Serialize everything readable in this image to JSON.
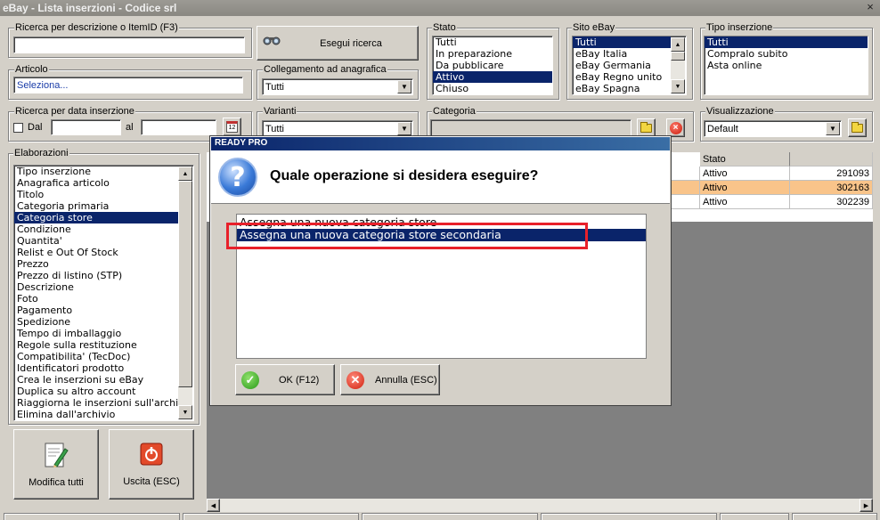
{
  "window": {
    "title": "eBay - Lista inserzioni - Codice srl",
    "close_glyph": "×"
  },
  "search": {
    "label": "Ricerca per descrizione o ItemID (F3)",
    "value": "",
    "button_label": "Esegui ricerca"
  },
  "articolo": {
    "label": "Articolo",
    "link": "Seleziona..."
  },
  "collegamento": {
    "label": "Collegamento ad anagrafica",
    "value": "Tutti"
  },
  "data_inserzione": {
    "label": "Ricerca per data inserzione",
    "dal_label": "Dal",
    "al_label": "al",
    "calendar_glyph": "12"
  },
  "varianti": {
    "label": "Varianti",
    "value": "Tutti"
  },
  "categoria": {
    "label": "Categoria",
    "value": ""
  },
  "stato": {
    "label": "Stato",
    "items": [
      "Tutti",
      "In preparazione",
      "Da pubblicare",
      "Attivo",
      "Chiuso"
    ],
    "selected_index": 3
  },
  "sito_ebay": {
    "label": "Sito eBay",
    "items": [
      "Tutti",
      "eBay Italia",
      "eBay Germania",
      "eBay Regno unito",
      "eBay Spagna"
    ],
    "selected_index": 0
  },
  "tipo_inserzione": {
    "label": "Tipo inserzione",
    "items": [
      "Tutti",
      "Compralo subito",
      "Asta online"
    ],
    "selected_index": 0
  },
  "visualizzazione": {
    "label": "Visualizzazione",
    "value": "Default"
  },
  "elaborazioni": {
    "label": "Elaborazioni",
    "items": [
      "Tipo inserzione",
      "Anagrafica articolo",
      "Titolo",
      "Categoria primaria",
      "Categoria store",
      "Condizione",
      "Quantita'",
      "Relist e Out Of Stock",
      "Prezzo",
      "Prezzo di listino (STP)",
      "Descrizione",
      "Foto",
      "Pagamento",
      "Spedizione",
      "Tempo di imballaggio",
      "Regole sulla restituzione",
      "Compatibilita' (TecDoc)",
      "Identificatori prodotto",
      "Crea le inserzioni su eBay",
      "Duplica su altro account",
      "Riaggiorna le inserzioni sull'archivio",
      "Elimina dall'archivio"
    ],
    "selected_index": 4
  },
  "actions": {
    "modifica_label": "Modifica tutti",
    "uscita_label": "Uscita (ESC)"
  },
  "grid": {
    "header_stato": "Stato",
    "rows": [
      {
        "stato": "Attivo",
        "id": "291093",
        "highlight": false
      },
      {
        "stato": "Attivo",
        "id": "302163",
        "highlight": true
      },
      {
        "stato": "Attivo",
        "id": "302239",
        "highlight": false
      }
    ],
    "highlight_color": "#f9c48a"
  },
  "dialog": {
    "title": "READY PRO",
    "question": "Quale operazione si desidera eseguire?",
    "options": [
      "Assegna una nuova categoria store",
      "Assegna una nuova categoria store secondaria"
    ],
    "selected_index": 1,
    "ok_label": "OK (F12)",
    "cancel_label": "Annulla (ESC)",
    "question_glyph": "?",
    "ok_glyph": "✓",
    "cancel_glyph": "✕"
  },
  "colors": {
    "selection": "#0a246a",
    "annotation_box": "#e8202a"
  }
}
